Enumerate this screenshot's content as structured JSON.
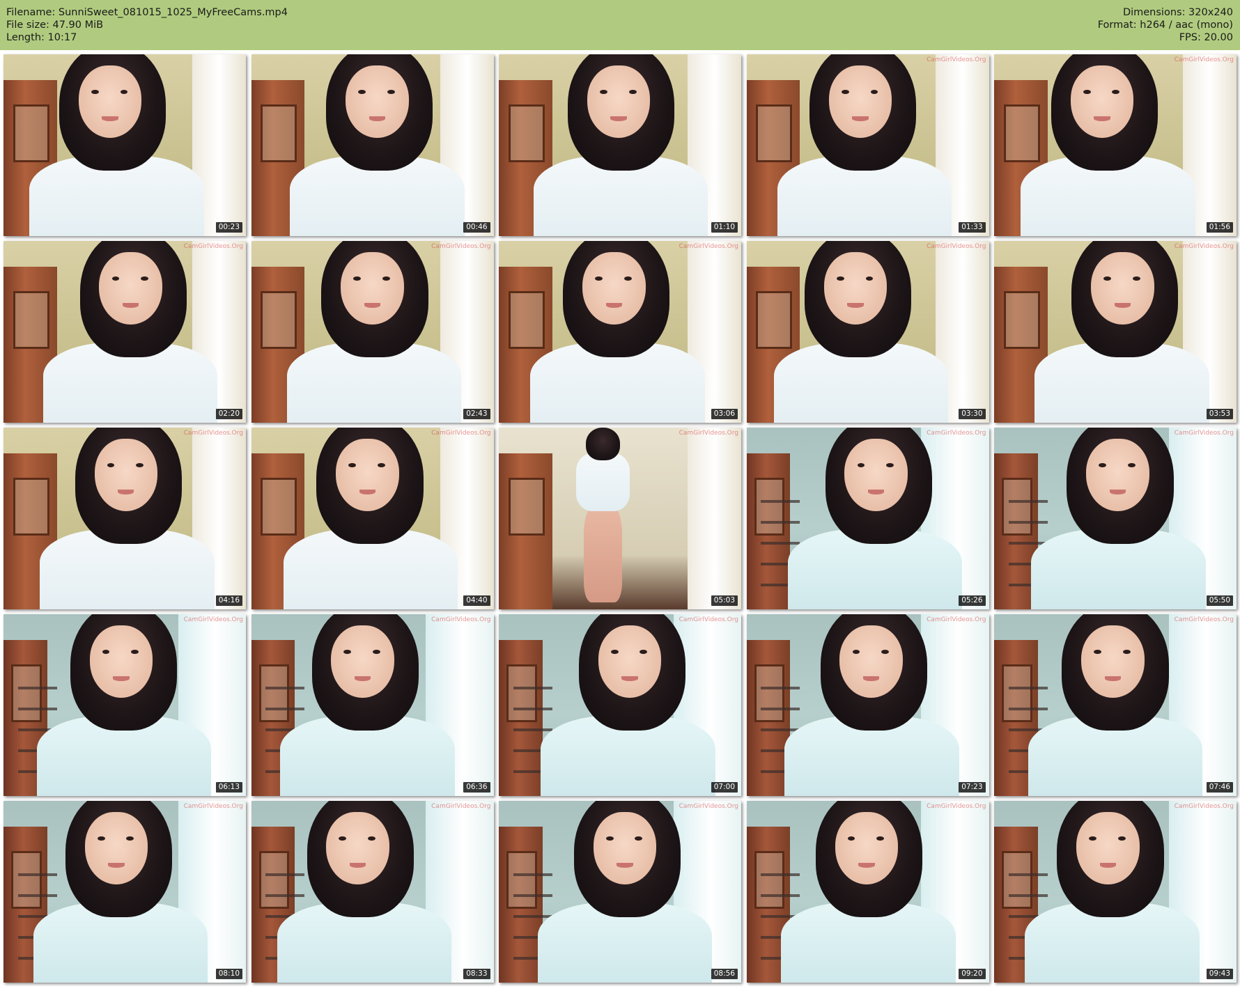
{
  "header": {
    "filename": "Filename: SunniSweet_081015_1025_MyFreeCams.mp4",
    "filesize": "File size: 47.90 MiB",
    "length": "Length: 10:17",
    "dimensions": "Dimensions: 320x240",
    "format": "Format: h264 / aac (mono)",
    "fps": "FPS: 20.00",
    "background_color": "#b0cb7f"
  },
  "thumbnails": [
    {
      "time": "00:23",
      "tone": "warm"
    },
    {
      "time": "00:46",
      "tone": "warm"
    },
    {
      "time": "01:10",
      "tone": "warm"
    },
    {
      "time": "01:33",
      "tone": "warm"
    },
    {
      "time": "01:56",
      "tone": "warm"
    },
    {
      "time": "02:20",
      "tone": "warm"
    },
    {
      "time": "02:43",
      "tone": "warm"
    },
    {
      "time": "03:06",
      "tone": "warm"
    },
    {
      "time": "03:30",
      "tone": "warm"
    },
    {
      "time": "03:53",
      "tone": "warm"
    },
    {
      "time": "04:16",
      "tone": "warm"
    },
    {
      "time": "04:40",
      "tone": "warm"
    },
    {
      "time": "05:03",
      "tone": "room"
    },
    {
      "time": "05:26",
      "tone": "cool"
    },
    {
      "time": "05:50",
      "tone": "cool"
    },
    {
      "time": "06:13",
      "tone": "cool"
    },
    {
      "time": "06:36",
      "tone": "cool"
    },
    {
      "time": "07:00",
      "tone": "cool"
    },
    {
      "time": "07:23",
      "tone": "cool"
    },
    {
      "time": "07:46",
      "tone": "cool"
    },
    {
      "time": "08:10",
      "tone": "cool"
    },
    {
      "time": "08:33",
      "tone": "cool"
    },
    {
      "time": "08:56",
      "tone": "cool"
    },
    {
      "time": "09:20",
      "tone": "cool"
    },
    {
      "time": "09:43",
      "tone": "cool"
    }
  ],
  "watermark": "CamGirlVideos.Org"
}
